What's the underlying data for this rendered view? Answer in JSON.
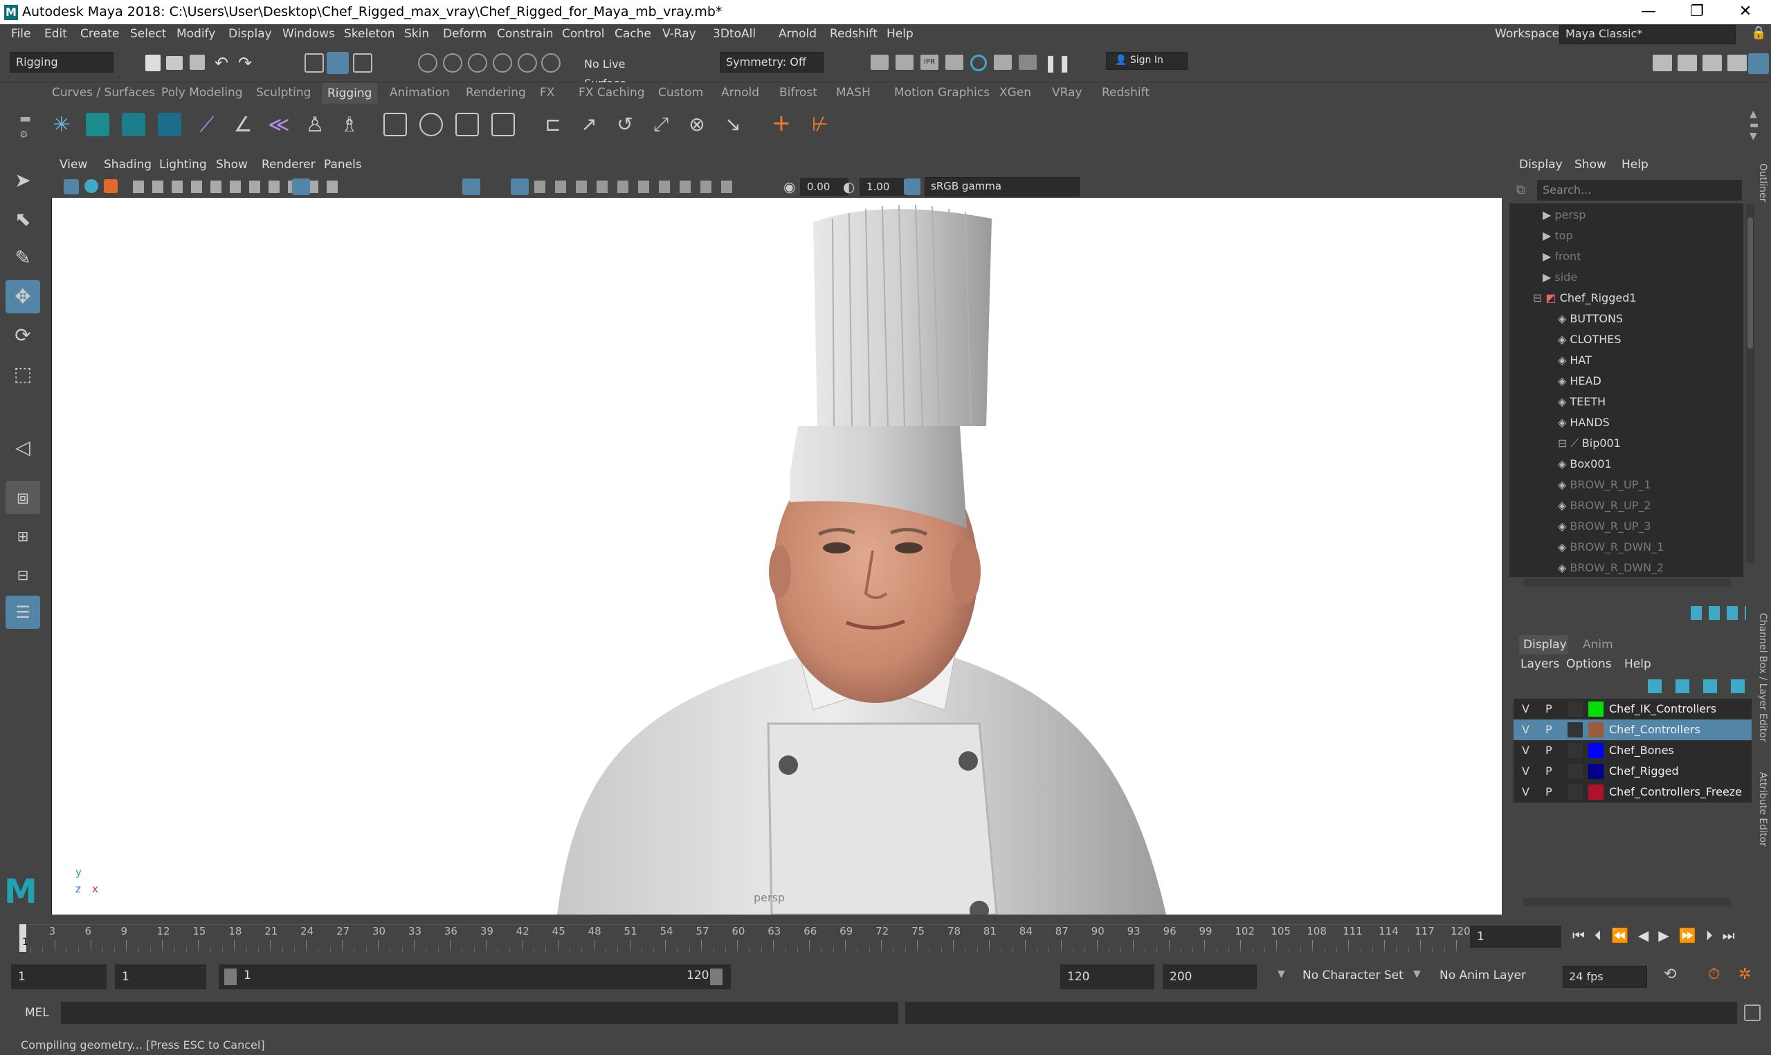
{
  "title_bar": {
    "logo": "M",
    "title": "Autodesk Maya 2018: C:\\Users\\User\\Desktop\\Chef_Rigged_max_vray\\Chef_Rigged_for_Maya_mb_vray.mb*",
    "min": "—",
    "max": "❐",
    "close": "✕"
  },
  "menu": [
    "File",
    "Edit",
    "Create",
    "Select",
    "Modify",
    "Display",
    "Windows",
    "Skeleton",
    "Skin",
    "Deform",
    "Constrain",
    "Control",
    "Cache",
    "V-Ray",
    "3DtoAll",
    "Arnold",
    "Redshift",
    "Help"
  ],
  "workspace": {
    "label": "Workspace :",
    "value": "Maya Classic*"
  },
  "status_line": {
    "menuset": "Rigging",
    "live_surface": "No Live Surface",
    "symmetry": "Symmetry: Off",
    "sign_in": "Sign In"
  },
  "shelf_tabs": [
    "Curves / Surfaces",
    "Poly Modeling",
    "Sculpting",
    "Rigging",
    "Animation",
    "Rendering",
    "FX",
    "FX Caching",
    "Custom",
    "Arnold",
    "Bifrost",
    "MASH",
    "Motion Graphics",
    "XGen",
    "VRay",
    "Redshift"
  ],
  "active_shelf": "Rigging",
  "viewport_menu": [
    "View",
    "Shading",
    "Lighting",
    "Show",
    "Renderer",
    "Panels"
  ],
  "viewport_toolbar": {
    "exposure": "0.00",
    "gamma": "1.00",
    "color_space": "sRGB gamma"
  },
  "viewport": {
    "camera_label": "persp",
    "axis_y": "y",
    "axis_z": "z",
    "axis_x": "x"
  },
  "outliner": {
    "menu": [
      "Display",
      "Show",
      "Help"
    ],
    "search_placeholder": "Search...",
    "items": [
      {
        "label": "persp",
        "kind": "camera",
        "dim": true
      },
      {
        "label": "top",
        "kind": "camera",
        "dim": true
      },
      {
        "label": "front",
        "kind": "camera",
        "dim": true
      },
      {
        "label": "side",
        "kind": "camera",
        "dim": true
      },
      {
        "label": "Chef_Rigged1",
        "kind": "group",
        "dim": false
      },
      {
        "label": "BUTTONS",
        "kind": "mesh",
        "dim": false
      },
      {
        "label": "CLOTHES",
        "kind": "mesh",
        "dim": false
      },
      {
        "label": "HAT",
        "kind": "mesh",
        "dim": false
      },
      {
        "label": "HEAD",
        "kind": "mesh",
        "dim": false
      },
      {
        "label": "TEETH",
        "kind": "mesh",
        "dim": false
      },
      {
        "label": "HANDS",
        "kind": "mesh",
        "dim": false
      },
      {
        "label": "Bip001",
        "kind": "joint",
        "dim": false
      },
      {
        "label": "Box001",
        "kind": "mesh",
        "dim": false
      },
      {
        "label": "BROW_R_UP_1",
        "kind": "mesh",
        "dim": true
      },
      {
        "label": "BROW_R_UP_2",
        "kind": "mesh",
        "dim": true
      },
      {
        "label": "BROW_R_UP_3",
        "kind": "mesh",
        "dim": true
      },
      {
        "label": "BROW_R_DWN_1",
        "kind": "mesh",
        "dim": true
      },
      {
        "label": "BROW_R_DWN_2",
        "kind": "mesh",
        "dim": true
      }
    ]
  },
  "layer_editor": {
    "tabs": [
      "Display",
      "Anim"
    ],
    "menu": [
      "Layers",
      "Options",
      "Help"
    ],
    "layers": [
      {
        "v": "V",
        "p": "P",
        "name": "Chef_IK_Controllers",
        "color": "#00e000",
        "selected": false
      },
      {
        "v": "V",
        "p": "P",
        "name": "Chef_Controllers",
        "color": "#9c5a3c",
        "selected": true
      },
      {
        "v": "V",
        "p": "P",
        "name": "Chef_Bones",
        "color": "#0000ff",
        "selected": false
      },
      {
        "v": "V",
        "p": "P",
        "name": "Chef_Rigged",
        "color": "#00008a",
        "selected": false
      },
      {
        "v": "V",
        "p": "P",
        "name": "Chef_Controllers_Freeze",
        "color": "#b0122c",
        "selected": false
      }
    ]
  },
  "side_tabs": [
    "Outliner",
    "Channel Box / Layer Editor",
    "Attribute Editor"
  ],
  "time_slider": {
    "ticks": [
      "3",
      "6",
      "9",
      "12",
      "15",
      "18",
      "21",
      "24",
      "27",
      "30",
      "33",
      "36",
      "39",
      "42",
      "45",
      "48",
      "51",
      "54",
      "57",
      "60",
      "63",
      "66",
      "69",
      "72",
      "75",
      "78",
      "81",
      "84",
      "87",
      "90",
      "93",
      "96",
      "99",
      "102",
      "105",
      "108",
      "111",
      "114",
      "117",
      "120"
    ],
    "current_marker": "1",
    "current_frame": "1"
  },
  "range": {
    "start": "1",
    "playback_start": "1",
    "slider_start": "1",
    "slider_end": "120",
    "playback_end": "120",
    "end": "200",
    "character_set": "No Character Set",
    "anim_layer": "No Anim Layer",
    "fps": "24 fps"
  },
  "command_line": {
    "label": "MEL"
  },
  "help_line": "Compiling geometry... [Press ESC to Cancel]"
}
